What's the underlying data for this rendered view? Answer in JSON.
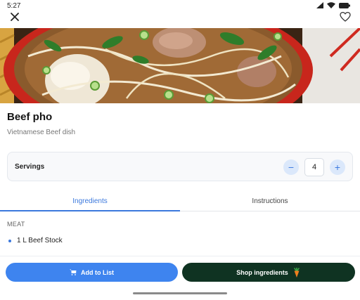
{
  "status": {
    "time": "5:27"
  },
  "recipe": {
    "title": "Beef pho",
    "subtitle": "Vietnamese Beef dish"
  },
  "servings": {
    "label": "Servings",
    "value": "4",
    "decrement_symbol": "−",
    "increment_symbol": "+"
  },
  "tabs": [
    {
      "label": "Ingredients",
      "active": true
    },
    {
      "label": "Instructions",
      "active": false
    }
  ],
  "ingredients": {
    "section": "MEAT",
    "items": [
      {
        "text": "1 L Beef Stock"
      },
      {
        "text": ""
      }
    ]
  },
  "actions": {
    "add_to_list": "Add to List",
    "shop_ingredients": "Shop ingredients"
  },
  "icons": {
    "close": "close-icon",
    "favorite": "heart-outline-icon",
    "cart": "cart-icon",
    "carrot": "carrot-icon"
  },
  "colors": {
    "accent": "#3b78dd",
    "primary_button": "#3e84ef",
    "shop_button": "#0f3322",
    "stepper_bg": "#dbe8fb"
  }
}
